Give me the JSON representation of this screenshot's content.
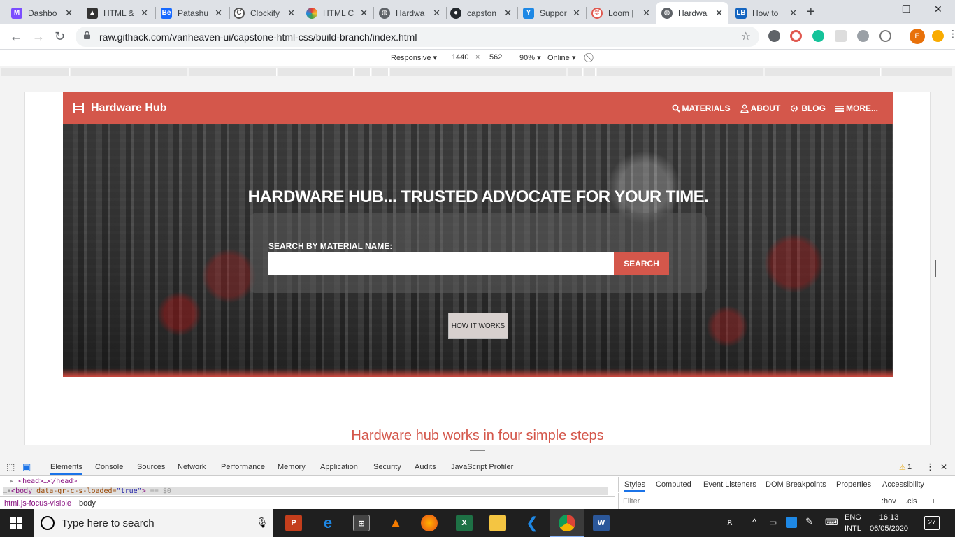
{
  "browser": {
    "tabs": [
      {
        "title": "Dashbo",
        "fav_color": "#7b4dff"
      },
      {
        "title": "HTML &",
        "fav_color": "#333333"
      },
      {
        "title": "Patashu",
        "fav_color": "#1769ff"
      },
      {
        "title": "Clockify",
        "fav_color": "#03a9f4"
      },
      {
        "title": "HTML C",
        "fav_color": "#e53935"
      },
      {
        "title": "Hardwa",
        "fav_color": "#5f6368"
      },
      {
        "title": "capston",
        "fav_color": "#24292e"
      },
      {
        "title": "Suppor",
        "fav_color": "#1e88e5"
      },
      {
        "title": "Loom |",
        "fav_color": "#e0584f"
      },
      {
        "title": "Hardwa",
        "fav_color": "#5f6368"
      },
      {
        "title": "How to",
        "fav_color": "#1565c0"
      }
    ],
    "url": "raw.githack.com/vanheaven-ui/capstone-html-css/build-branch/index.html",
    "profile_initial": "E"
  },
  "device_toolbar": {
    "mode": "Responsive ▾",
    "width": "1440",
    "times": "×",
    "height": "562",
    "zoom": "90% ▾",
    "network": "Online ▾"
  },
  "site": {
    "brand": "Hardware Hub",
    "nav": [
      {
        "label": "MATERIALS",
        "icon": "search-icon"
      },
      {
        "label": "ABOUT",
        "icon": "user-icon"
      },
      {
        "label": "BLOG",
        "icon": "blog-icon"
      },
      {
        "label": "MORE...",
        "icon": "menu-icon"
      }
    ],
    "hero_title": "HARDWARE  HUB... TRUSTED ADVOCATE  FOR YOUR TIME.",
    "search_label": "SEARCH  BY  MATERIAL  NAME:",
    "search_value": "",
    "search_button": "SEARCH",
    "how_button": "HOW IT WORKS",
    "steps_title": "Hardware hub works in four simple steps",
    "brand_color": "#d4574b"
  },
  "devtools": {
    "tabs": [
      "Elements",
      "Console",
      "Sources",
      "Network",
      "Performance",
      "Memory",
      "Application",
      "Security",
      "Audits",
      "JavaScript Profiler"
    ],
    "warning_count": "1",
    "dom_head": "<head>…</head>",
    "dom_body_tag": "<body",
    "dom_body_attr": " data-gr-c-s-loaded=",
    "dom_body_val": "\"true\"",
    "dom_body_end": ">",
    "dom_body_suffix": " == $0",
    "crumb_1": "html.js-focus-visible",
    "crumb_2": "body",
    "side_tabs": [
      "Styles",
      "Computed",
      "Event Listeners",
      "DOM Breakpoints",
      "Properties",
      "Accessibility"
    ],
    "filter_placeholder": "Filter",
    "hov": ":hov",
    "cls": ".cls"
  },
  "taskbar": {
    "search_placeholder": "Type here to search",
    "lang_line1": "ENG",
    "lang_line2": "INTL",
    "time": "16:13",
    "date": "06/05/2020",
    "notifications": "27"
  }
}
